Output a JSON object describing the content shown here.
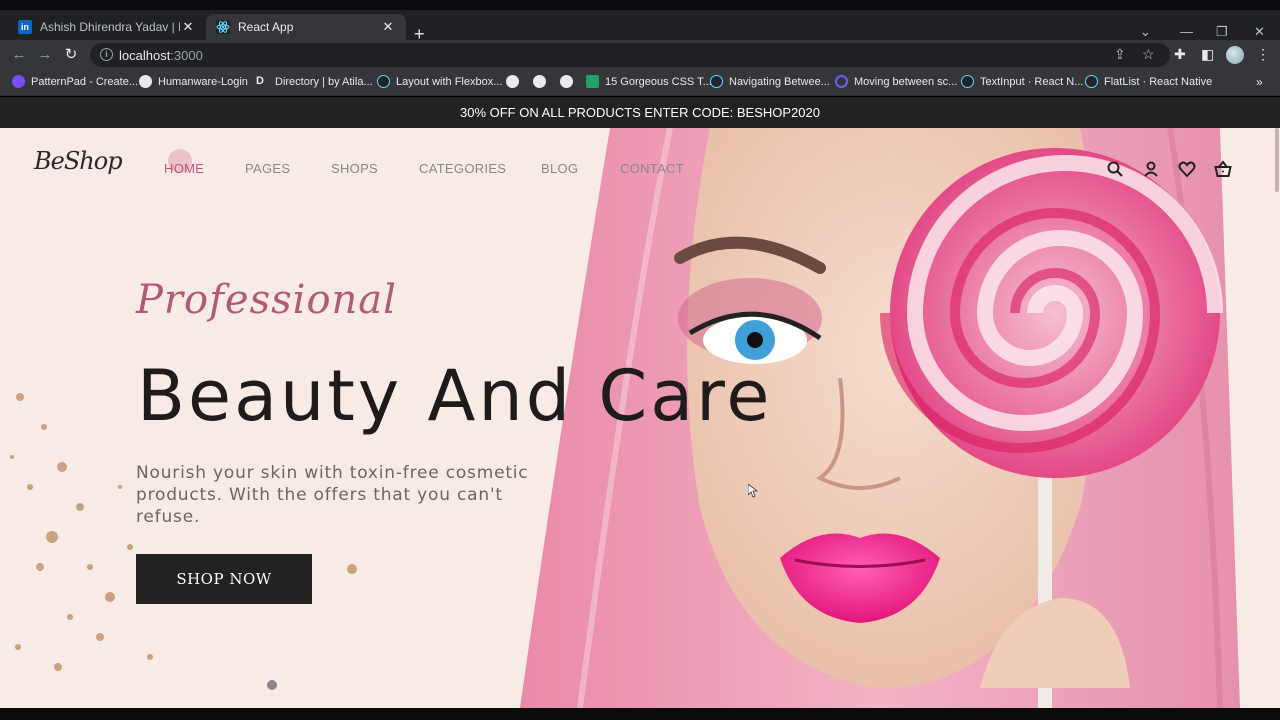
{
  "browser": {
    "tabs": [
      {
        "title": "Ashish Dhirendra Yadav | Linkedl",
        "favicon": "linkedin-icon",
        "active": false
      },
      {
        "title": "React App",
        "favicon": "react-icon",
        "active": true
      }
    ],
    "new_tab": "+",
    "url_host": "localhost",
    "url_port": ":3000",
    "bookmarks": [
      {
        "label": "PatternPad - Create...",
        "icon": "patternpad-icon"
      },
      {
        "label": "Humanware-Login",
        "icon": "globe-icon"
      },
      {
        "label": "Directory | by Atila...",
        "icon": "d-letter-icon"
      },
      {
        "label": "Layout with Flexbox...",
        "icon": "react-icon"
      },
      {
        "label": "",
        "icon": "globe-icon"
      },
      {
        "label": "",
        "icon": "globe-icon"
      },
      {
        "label": "",
        "icon": "globe-icon"
      },
      {
        "label": "15 Gorgeous CSS T...",
        "icon": "green-doc-icon"
      },
      {
        "label": "Navigating Betwee...",
        "icon": "react-icon"
      },
      {
        "label": "Moving between sc...",
        "icon": "spinner-icon"
      },
      {
        "label": "TextInput · React N...",
        "icon": "react-icon"
      },
      {
        "label": "FlatList · React Native",
        "icon": "react-icon"
      }
    ],
    "more": "»"
  },
  "site": {
    "promo": "30% OFF ON ALL PRODUCTS ENTER CODE: BESHOP2020",
    "logo": "BeShop",
    "nav": [
      "HOME",
      "PAGES",
      "SHOPS",
      "CATEGORIES",
      "BLOG",
      "CONTACT"
    ],
    "active_nav": "HOME",
    "header_icons": [
      "search-icon",
      "user-icon",
      "heart-icon",
      "basket-icon"
    ],
    "hero": {
      "script": "Professional",
      "headline": "Beauty And Care",
      "sub_line1": "Nourish your skin with toxin-free cosmetic",
      "sub_line2": "products. With the offers that you can't refuse.",
      "button": "SHOP NOW"
    }
  },
  "colors": {
    "page_bg": "#f8ebe6",
    "accent": "#c5527a",
    "promo_bg": "#222222",
    "chrome_dark": "#202124",
    "chrome_mid": "#35363a"
  }
}
